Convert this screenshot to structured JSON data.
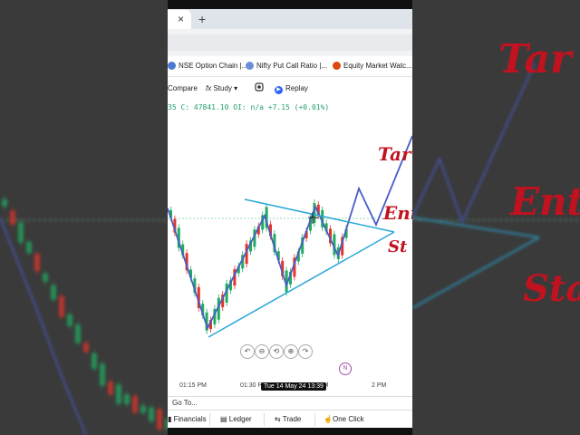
{
  "browser": {
    "tab_close": "×",
    "new_tab": "+",
    "bookmarks": [
      {
        "label": "NSE Option Chain |...",
        "icon_color": "#4a7bd0"
      },
      {
        "label": "Nifty Put Call Ratio |...",
        "icon_color": "#6a8fd8"
      },
      {
        "label": "Equity Market Watc...",
        "icon_color": "#d9480f"
      }
    ]
  },
  "toolbar": {
    "compare_label": "Compare",
    "study_label": "Study",
    "study_prefix": "fx",
    "replay_label": "Replay"
  },
  "ohlc_line": "35 C: 47841.10 OI: n/a +7.15 (+0.01%)",
  "annotations": {
    "target": "Tar",
    "entry": "Ent",
    "stop": "St",
    "right_target": "Tar",
    "right_entry": "Ent",
    "right_stop": "Sta"
  },
  "chart_data": {
    "type": "candlestick",
    "x_ticks": [
      "01:15 PM",
      "01:30 PM",
      "PM",
      "2 PM"
    ],
    "crosshair_label": "Tue 14 May 24 13:39",
    "colors": {
      "up": "#22ab60",
      "down": "#e0352b",
      "pattern": "#4a5cc7",
      "trend": "#29a8d8",
      "level": "#6fcf97",
      "text": "#c1121f"
    }
  },
  "zoom_controls": [
    "↶",
    "⊖",
    "⟲",
    "⊕",
    "↷"
  ],
  "n_badge": "N",
  "goto_label": "Go To...",
  "bottom": {
    "financials": "Financials",
    "ledger": "Ledger",
    "trade": "Trade",
    "one_click": "One Click"
  }
}
